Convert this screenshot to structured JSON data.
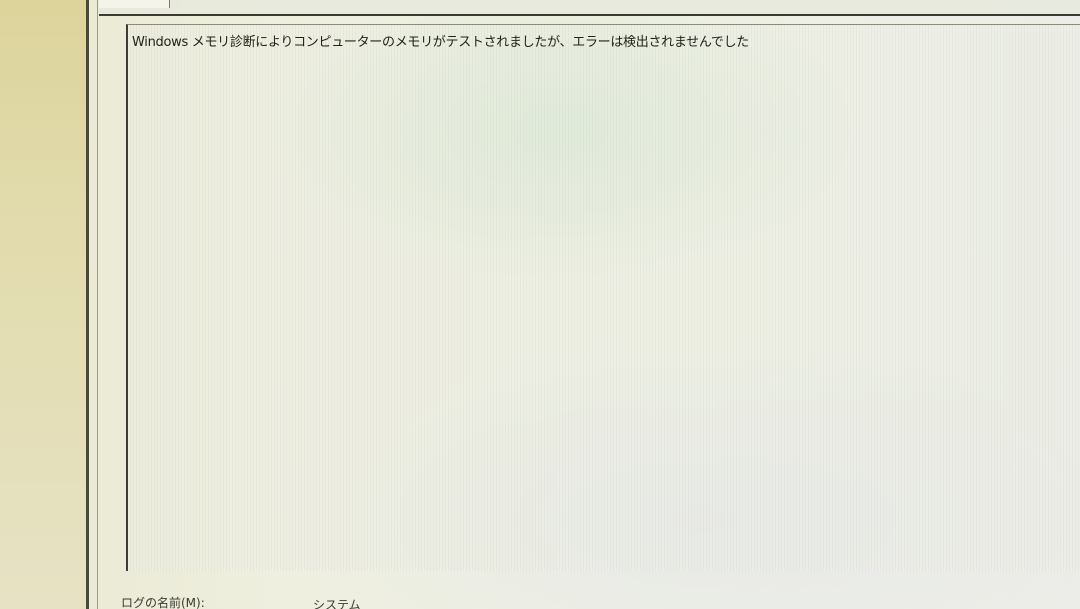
{
  "event_details": {
    "message": "Windows メモリ診断によりコンピューターのメモリがテストされましたが、エラーは検出されませんでした"
  },
  "fields": {
    "log_name_label": "ログの名前(M):",
    "log_name_value": "システム"
  }
}
